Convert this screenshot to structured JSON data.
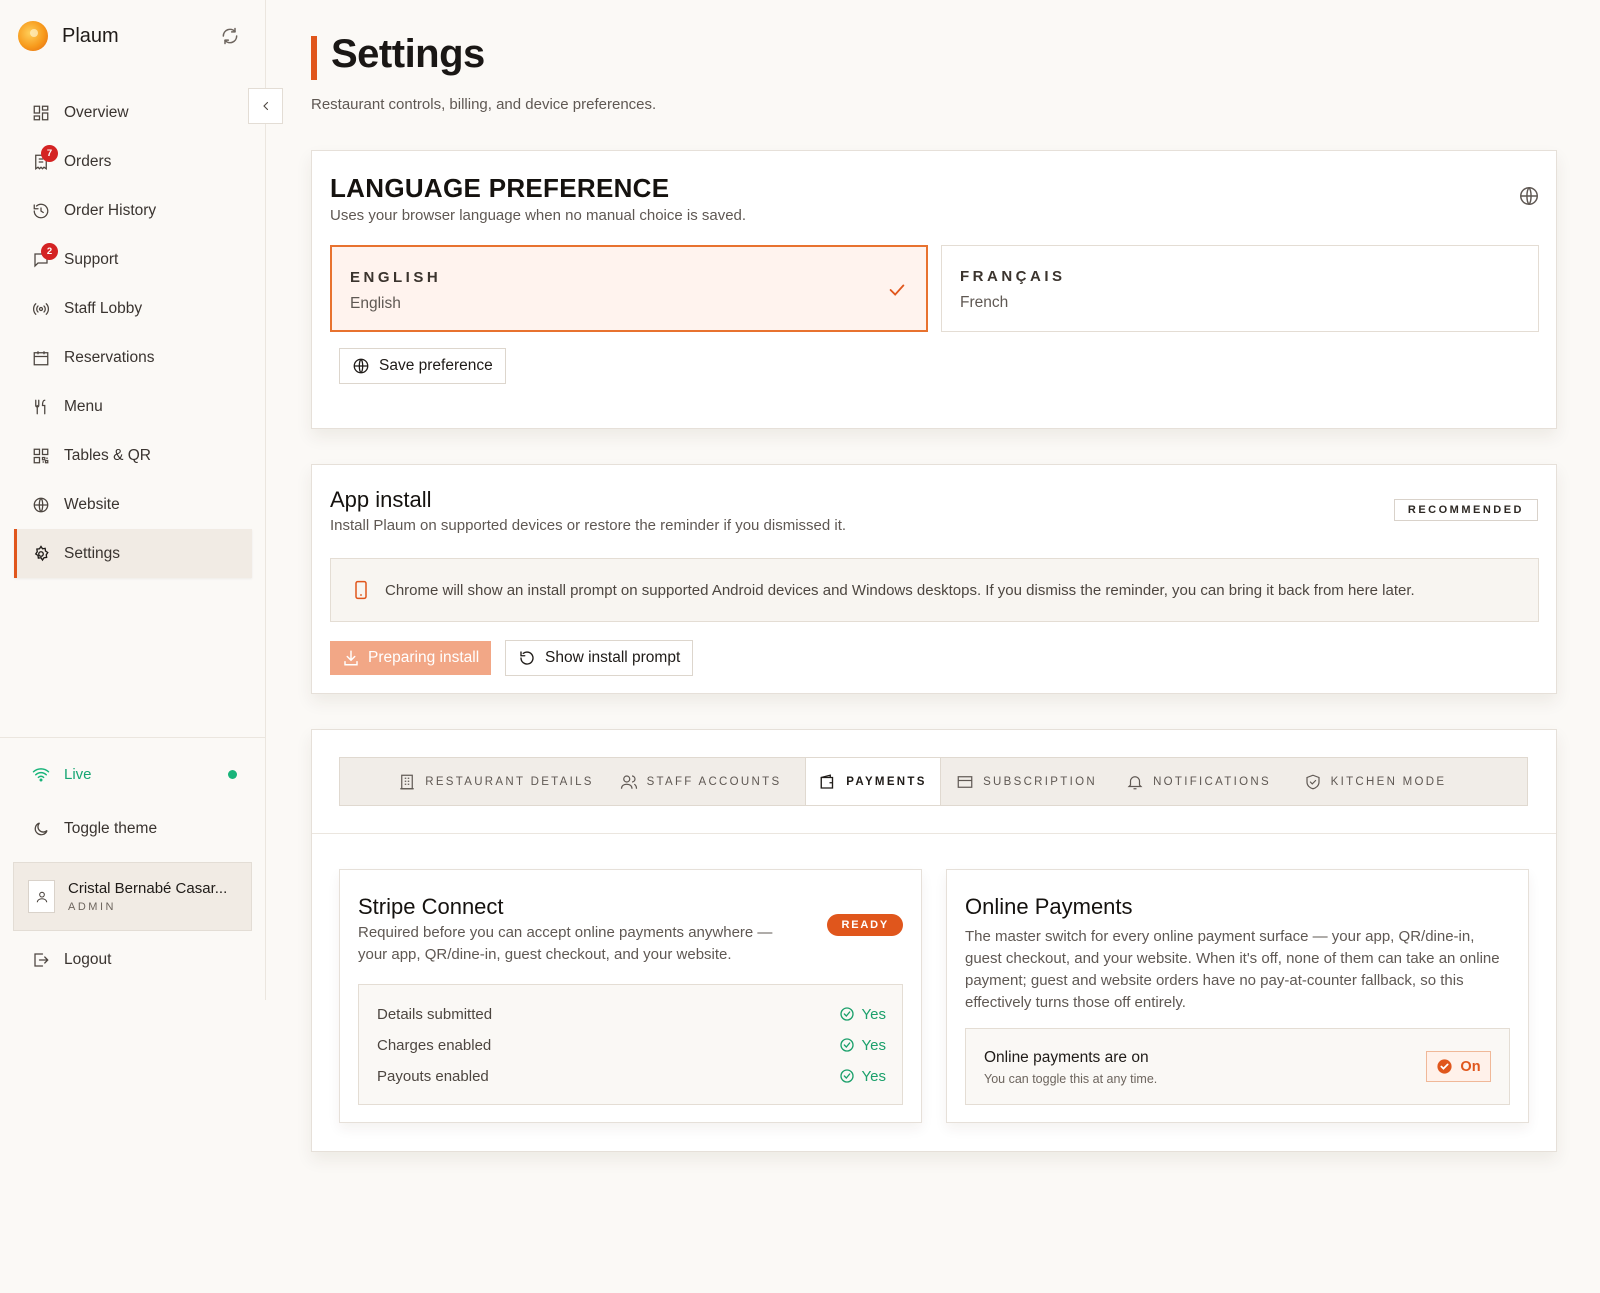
{
  "app": {
    "name": "Plaum"
  },
  "sidebar": {
    "items": [
      {
        "label": "Overview",
        "icon": "grid-icon"
      },
      {
        "label": "Orders",
        "icon": "receipt-icon",
        "badge": "7"
      },
      {
        "label": "Order History",
        "icon": "history-icon"
      },
      {
        "label": "Support",
        "icon": "chat-icon",
        "badge": "2"
      },
      {
        "label": "Staff Lobby",
        "icon": "broadcast-icon"
      },
      {
        "label": "Reservations",
        "icon": "calendar-icon"
      },
      {
        "label": "Menu",
        "icon": "utensils-icon"
      },
      {
        "label": "Tables & QR",
        "icon": "qr-icon"
      },
      {
        "label": "Website",
        "icon": "globe-icon"
      },
      {
        "label": "Settings",
        "icon": "gear-icon",
        "active": true
      }
    ],
    "status": "Live",
    "toggle_theme": "Toggle theme",
    "user": {
      "name": "Cristal Bernabé Casar...",
      "role": "ADMIN"
    },
    "logout": "Logout"
  },
  "page": {
    "title": "Settings",
    "subtitle": "Restaurant controls, billing, and device preferences."
  },
  "language": {
    "title": "LANGUAGE PREFERENCE",
    "subtitle": "Uses your browser language when no manual choice is saved.",
    "options": [
      {
        "name": "ENGLISH",
        "sub": "English",
        "selected": true
      },
      {
        "name": "FRANÇAIS",
        "sub": "French",
        "selected": false
      }
    ],
    "save_label": "Save preference"
  },
  "install": {
    "title": "App install",
    "subtitle": "Install Plaum on supported devices or restore the reminder if you dismissed it.",
    "badge": "RECOMMENDED",
    "info": "Chrome will show an install prompt on supported Android devices and Windows desktops. If you dismiss the reminder, you can bring it back from here later.",
    "primary_label": "Preparing install",
    "secondary_label": "Show install prompt"
  },
  "tabs": [
    {
      "label": "RESTAURANT DETAILS",
      "icon": "building-icon"
    },
    {
      "label": "STAFF ACCOUNTS",
      "icon": "users-icon"
    },
    {
      "label": "PAYMENTS",
      "icon": "wallet-icon",
      "active": true
    },
    {
      "label": "SUBSCRIPTION",
      "icon": "credit-card-icon"
    },
    {
      "label": "NOTIFICATIONS",
      "icon": "bell-icon"
    },
    {
      "label": "KITCHEN MODE",
      "icon": "shield-icon"
    }
  ],
  "stripe": {
    "title": "Stripe Connect",
    "description": "Required before you can accept online payments anywhere — your app, QR/dine-in, guest checkout, and your website.",
    "badge": "READY",
    "rows": [
      {
        "label": "Details submitted",
        "value": "Yes"
      },
      {
        "label": "Charges enabled",
        "value": "Yes"
      },
      {
        "label": "Payouts enabled",
        "value": "Yes"
      }
    ]
  },
  "online_payments": {
    "title": "Online Payments",
    "description": "The master switch for every online payment surface — your app, QR/dine-in, guest checkout, and your website. When it's off, none of them can take an online payment; guest and website orders have no pay-at-counter fallback, so this effectively turns those off entirely.",
    "status_title": "Online payments are on",
    "status_sub": "You can toggle this at any time.",
    "toggle_label": "On"
  },
  "colors": {
    "accent": "#e0561c",
    "success": "#1ba06b",
    "badge_red": "#d42323"
  }
}
